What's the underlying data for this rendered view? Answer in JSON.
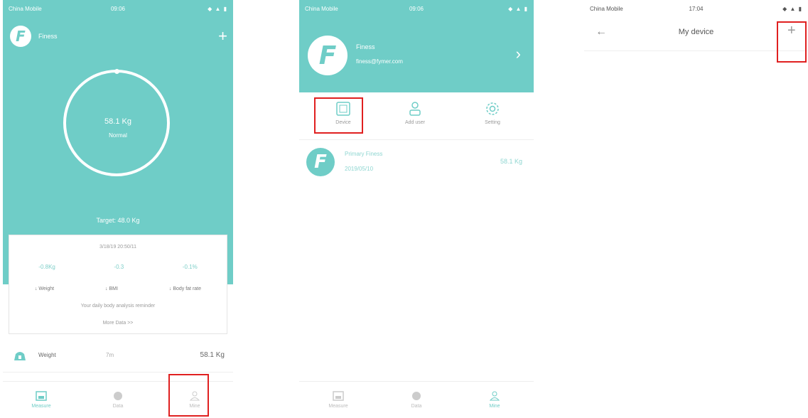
{
  "screen1": {
    "status": {
      "carrier": "China Mobile",
      "time": "09:06",
      "icons": "◆ ▲ ▮"
    },
    "header": {
      "user_name": "Finess",
      "add_symbol": "+"
    },
    "ring": {
      "weight": "58.1 Kg",
      "status": "Normal"
    },
    "target": "Target: 48.0 Kg",
    "card": {
      "title": "3/18/19 20:50/11",
      "values": [
        "-0.8Kg",
        "-0.3",
        "-0.1%"
      ],
      "labels": [
        "↓ Weight",
        "↓ BMI",
        "↓ Body fat rate"
      ],
      "note": "Your daily body analysis reminder",
      "more": "More Data >>"
    },
    "weight_row": {
      "label": "Weight",
      "time": "7m",
      "value": "58.1 Kg"
    },
    "tabs": [
      "Measure",
      "Data",
      "Mine"
    ]
  },
  "screen2": {
    "status": {
      "carrier": "China Mobile",
      "time": "09:06",
      "icons": "◆ ▲ ▮"
    },
    "profile": {
      "name": "Finess",
      "email": "finess@fymer.com",
      "chevron": "›"
    },
    "menu": [
      "Device",
      "Add user",
      "Setting"
    ],
    "user_row": {
      "name": "Primary Finess",
      "date": "2019/05/10",
      "value": "58.1 Kg"
    },
    "tabs": [
      "Measure",
      "Data",
      "Mine"
    ]
  },
  "screen3": {
    "status": {
      "carrier": "China Mobile",
      "time": "17:04",
      "icons": "◆ ▲ ▮"
    },
    "nav": {
      "back": "←",
      "title": "My device",
      "add": "+"
    }
  },
  "colors": {
    "accent": "#6fcdc7",
    "highlight": "#e02020"
  }
}
